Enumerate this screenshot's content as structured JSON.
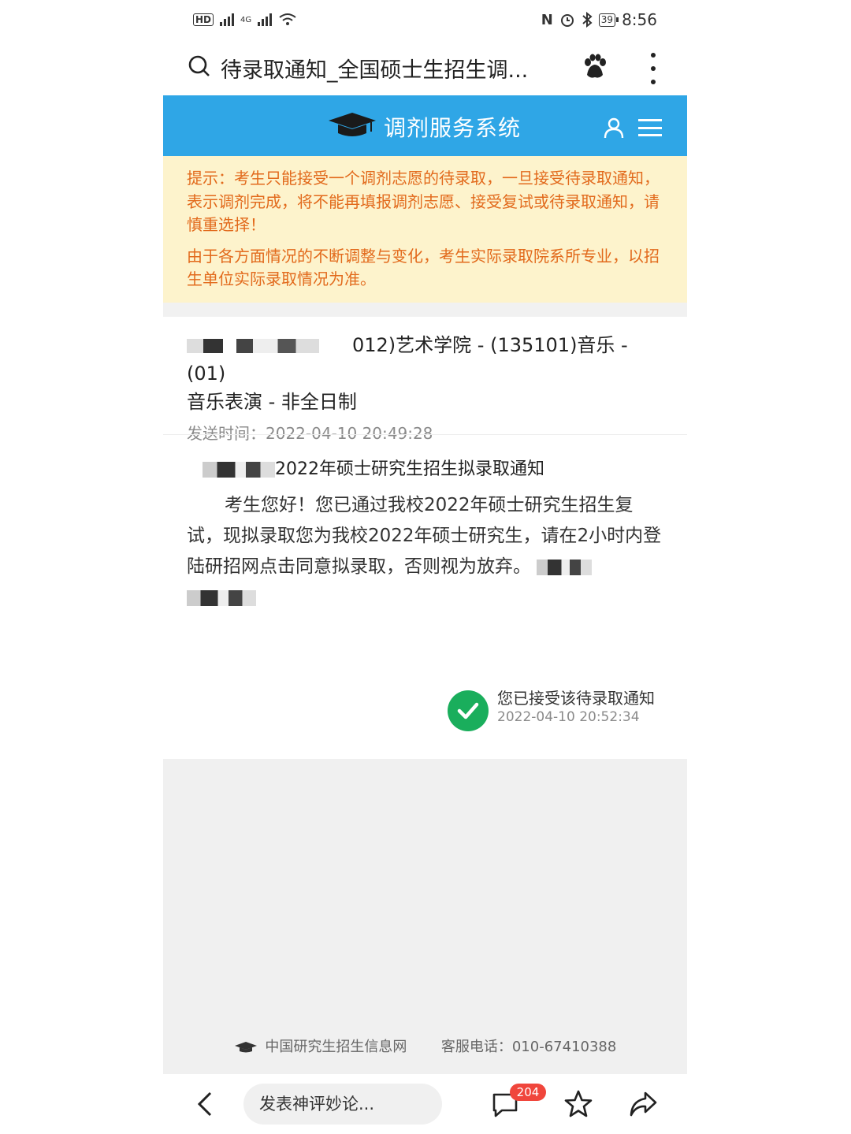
{
  "status_bar": {
    "left_badge": "HD",
    "network": "4G",
    "battery": "39",
    "time": "8:56"
  },
  "browser": {
    "page_title": "待录取通知_全国硕士生招生调..."
  },
  "header": {
    "title": "调剂服务系统",
    "bg_color": "#2fa6e6"
  },
  "notice": {
    "text1": "提示：考生只能接受一个调剂志愿的待录取，一旦接受待录取通知，表示调剂完成，将不能再填报调剂志愿、接受复试或待录取通知，请慎重选择！",
    "text2": "由于各方面情况的不断调整与变化，考生实际录取院系所专业，以招生单位实际录取情况为准。",
    "color": "#e26a1c"
  },
  "notification": {
    "program_line1": "012)艺术学院 - (135101)音乐 - (01)",
    "program_line2": "音乐表演 - 非全日制",
    "sent_time": "发送时间：2022-04-10 20:49:28"
  },
  "letter": {
    "title": "2022年硕士研究生招生拟录取通知",
    "body": "考生您好！您已通过我校2022年硕士研究生招生复试，现拟录取您为我校2022年硕士研究生，请在2小时内登陆研招网点击同意拟录取，否则视为放弃。"
  },
  "accepted": {
    "text": "您已接受该待录取通知",
    "time": "2022-04-10 20:52:34",
    "color": "#1aae5c"
  },
  "footer": {
    "site": "中国研究生招生信息网",
    "phone": "客服电话：010-67410388"
  },
  "bottom_bar": {
    "comment_placeholder": "发表神评妙论...",
    "comment_count": "204"
  }
}
